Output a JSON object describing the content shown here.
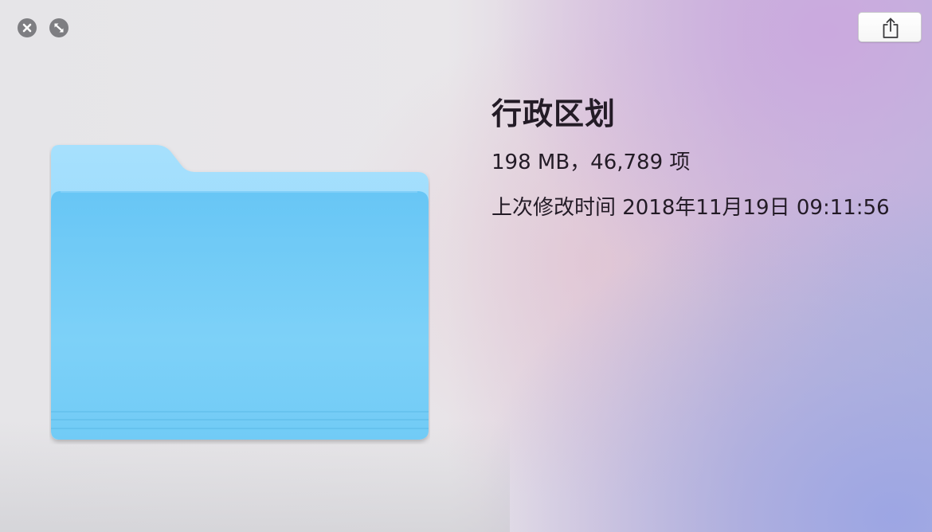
{
  "window": {
    "close_icon": "close-icon",
    "fullscreen_icon": "fullscreen-icon",
    "share_icon": "share-icon"
  },
  "file": {
    "icon": "folder-icon",
    "name": "行政区划",
    "size_and_count": "198 MB，46,789 项",
    "modified": "上次修改时间 2018年11月19日 09:11:56"
  },
  "colors": {
    "folder_front": "#6ec9f5",
    "folder_back": "#9bdbfb",
    "text": "#231b26",
    "control_gray": "#7e7e82"
  }
}
